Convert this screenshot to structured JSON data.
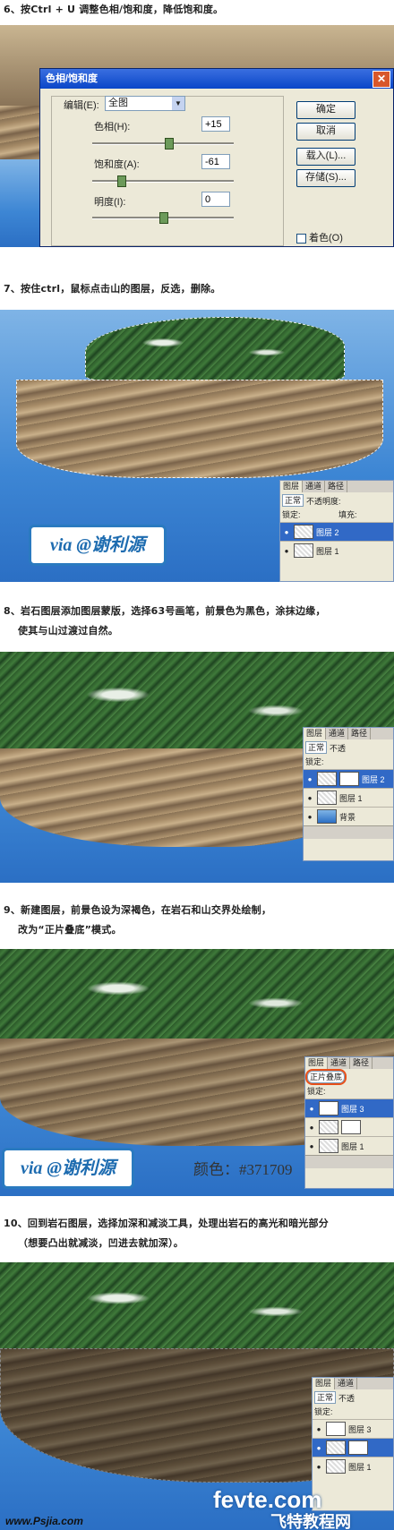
{
  "steps": [
    {
      "line1": "6、按Ctrl + U 调整色相/饱和度，降低饱和度。",
      "line2": ""
    },
    {
      "line1": "7、按住ctrl，鼠标点击山的图层，反选，删除。",
      "line2": ""
    },
    {
      "line1": "8、岩石图层添加图层蒙版，选择63号画笔，前景色为黑色，涂抹边缘，",
      "line2": "使其与山过渡过自然。"
    },
    {
      "line1": "9、新建图层，前景色设为深褐色，在岩石和山交界处绘制，",
      "line2": "改为“正片叠底”模式。"
    },
    {
      "line1": "10、回到岩石图层，选择加深和减淡工具，处理出岩石的高光和暗光部分",
      "line2": "（想要凸出就减淡，凹进去就加深）。"
    }
  ],
  "dialog": {
    "title": "色相/饱和度",
    "close": "✕",
    "edit_label": "编辑(E):",
    "edit_value": "全图",
    "hue_label": "色相(H):",
    "hue_value": "+15",
    "hue_level": 0.54,
    "sat_label": "饱和度(A):",
    "sat_value": "-61",
    "sat_level": 0.2,
    "light_label": "明度(I):",
    "light_value": "0",
    "light_level": 0.5,
    "ok": "确定",
    "cancel": "取消",
    "load": "载入(L)...",
    "save": "存储(S)...",
    "colorize": "着色(O)"
  },
  "panels": {
    "tabs": [
      "图层",
      "通道",
      "路径"
    ],
    "mode_normal": "正常",
    "mode_multiply": "正片叠底",
    "opacity": "不透明度:",
    "opacity_short": "不透",
    "lock": "锁定:",
    "fill": "填充:",
    "layer1": "图层 1",
    "layer2": "图层 2",
    "layer3": "图层 3",
    "background": "背景"
  },
  "logo": {
    "text": "via @谢利源"
  },
  "color_note": "颜色：#371709",
  "watermark": {
    "site": "fevte.com",
    "cn": "飞特教程网",
    "bottom": "www.Psjia.com"
  },
  "colors": {
    "accent": "#1e6cb0",
    "sky": "#2b6fc4",
    "dialog_bg": "#ece9d8"
  }
}
